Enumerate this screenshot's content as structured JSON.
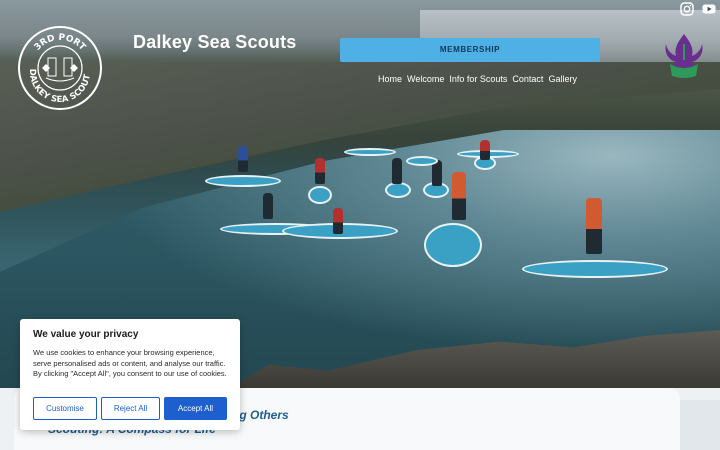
{
  "site": {
    "title": "Dalkey Sea Scouts",
    "logo_text_top": "3RD PORT",
    "logo_text_bottom": "DALKEY SEA SCOUTS"
  },
  "header": {
    "membership_label": "MEMBERSHIP",
    "nav": [
      "Home",
      "Welcome",
      "Info for Scouts",
      "Contact",
      "Gallery"
    ]
  },
  "social": {
    "instagram_icon": "instagram-icon",
    "youtube_icon": "youtube-icon"
  },
  "content": {
    "headline_fragment": "ng Others",
    "subhead": "Scouting: A Compass for Life"
  },
  "cookie": {
    "title": "We value your privacy",
    "body": "We use cookies to enhance your browsing experience, serve personalised ads or content, and analyse our traffic. By clicking \"Accept All\", you consent to our use of cookies.",
    "customise_label": "Customise",
    "reject_label": "Reject All",
    "accept_label": "Accept All"
  },
  "colors": {
    "accent": "#4fb0e6",
    "cookie_button": "#1e5fcf",
    "headline": "#1d5f92"
  }
}
